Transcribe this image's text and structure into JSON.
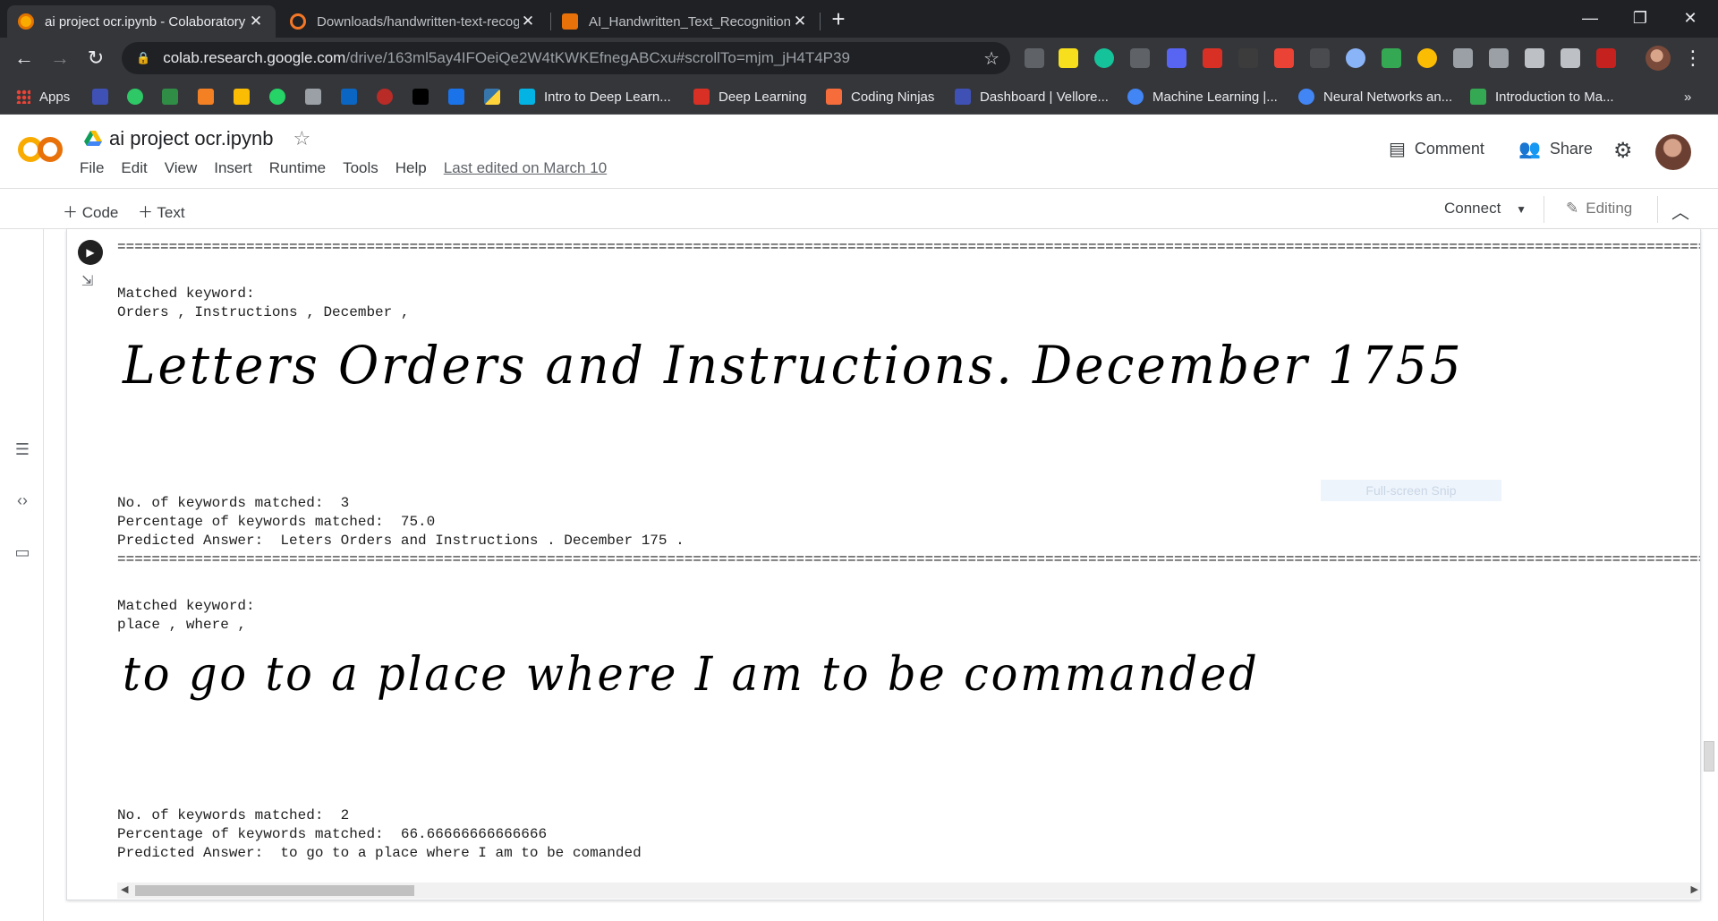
{
  "browser": {
    "tabs": [
      {
        "title": "ai project ocr.ipynb - Colaboratory",
        "favicon": "colab-icon",
        "color": "#f9ab00",
        "active": true
      },
      {
        "title": "Downloads/handwritten-text-recognition",
        "favicon": "jupyter-icon",
        "color": "#f37726",
        "active": false
      },
      {
        "title": "AI_Handwritten_Text_Recognition",
        "favicon": "book-icon",
        "color": "#e8710a",
        "active": false
      }
    ],
    "url_host": "colab.research.google.com",
    "url_path": "/drive/163ml5ay4IFOeiQe2W4tKWKEfnegABCxu#scrollTo=mjm_jH4T4P39",
    "bookmarks": [
      {
        "label": "Apps",
        "icon": "apps-icon",
        "color": "#ea4335"
      },
      {
        "label": "",
        "icon": "bookmark-icon",
        "color": "#3f51b5"
      },
      {
        "label": "",
        "icon": "hackerrank-icon",
        "color": "#2ec866"
      },
      {
        "label": "",
        "icon": "geeksforgeeks-icon",
        "color": "#2f8d46"
      },
      {
        "label": "",
        "icon": "stack-icon",
        "color": "#f48024"
      },
      {
        "label": "",
        "icon": "google-drive-icon",
        "color": "#fbbc04"
      },
      {
        "label": "",
        "icon": "whatsapp-icon",
        "color": "#25d366"
      },
      {
        "label": "",
        "icon": "document-icon",
        "color": "#9aa0a6"
      },
      {
        "label": "",
        "icon": "linkedin-icon",
        "color": "#0a66c2"
      },
      {
        "label": "",
        "icon": "quora-icon",
        "color": "#b92b27"
      },
      {
        "label": "",
        "icon": "medium-icon",
        "color": "#000000"
      },
      {
        "label": "",
        "icon": "k-icon",
        "color": "#1a73e8"
      },
      {
        "label": "",
        "icon": "python-icon",
        "color": "#3776ab"
      },
      {
        "label": "Intro to Deep Learn...",
        "icon": "udacity-icon",
        "color": "#02b3e4"
      },
      {
        "label": "Deep Learning",
        "icon": "nptel-icon",
        "color": "#d93025"
      },
      {
        "label": "Coding Ninjas",
        "icon": "coding-ninjas-icon",
        "color": "#f66c3b"
      },
      {
        "label": "Dashboard | Vellore...",
        "icon": "vit-icon",
        "color": "#3f51b5"
      },
      {
        "label": "Machine Learning |...",
        "icon": "coursera-icon",
        "color": "#4285f4"
      },
      {
        "label": "Neural Networks an...",
        "icon": "coursera-icon",
        "color": "#4285f4"
      },
      {
        "label": "Introduction to Ma...",
        "icon": "course-icon",
        "color": "#34a853"
      }
    ]
  },
  "colab": {
    "doc_title": "ai project ocr.ipynb",
    "menu": [
      "File",
      "Edit",
      "View",
      "Insert",
      "Runtime",
      "Tools",
      "Help"
    ],
    "last_edited": "Last edited on March 10",
    "comment_label": "Comment",
    "share_label": "Share",
    "add_code_label": "Code",
    "add_text_label": "Text",
    "connect_label": "Connect",
    "editing_label": "Editing",
    "brand_color": "#f9ab00"
  },
  "output": {
    "separator": "================================================================================================================================================================================================================================",
    "blocks": [
      {
        "matched_header": "Matched keyword:",
        "matched_keywords": "Orders , Instructions , December ,",
        "handwriting": "Letters Orders and Instructions. December 1755",
        "count_line": "No. of keywords matched:  3",
        "percent_line": "Percentage of keywords matched:  75.0",
        "predicted_line": "Predicted Answer:  Leters Orders and Instructions . December 175 ."
      },
      {
        "matched_header": "Matched keyword:",
        "matched_keywords": "place , where ,",
        "handwriting": "to go to a place where I am to be commanded",
        "count_line": "No. of keywords matched:  2",
        "percent_line": "Percentage of keywords matched:  66.66666666666666",
        "predicted_line": "Predicted Answer:  to go to a place where I am to be comanded"
      }
    ],
    "snip_label": "Full-screen Snip"
  }
}
